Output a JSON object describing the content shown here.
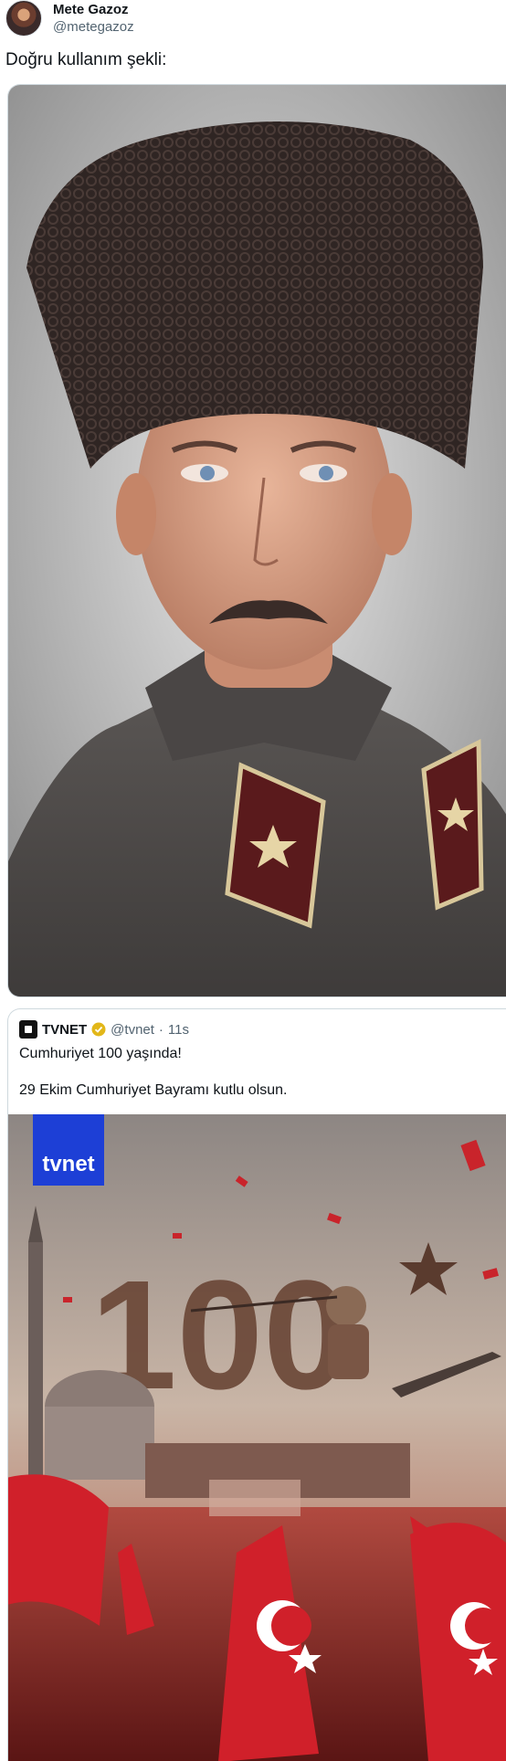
{
  "author": {
    "name": "Mete Gazoz",
    "handle": "@metegazoz"
  },
  "tweet": {
    "text": "Doğru kullanım şekli:"
  },
  "quoted": {
    "name": "TVNET",
    "handle": "@tvnet",
    "separator": "·",
    "time": "11s",
    "line1": "Cumhuriyet 100 yaşında!",
    "line2": "29 Ekim Cumhuriyet Bayramı kutlu olsun.",
    "image": {
      "logo_text": "tvnet",
      "big_number": "100"
    }
  },
  "colors": {
    "text": "#0f1419",
    "secondary": "#536471",
    "border": "#cfd9de",
    "verified": "#e2b719",
    "flag_red": "#d0202a",
    "tvnet_blue": "#1d3fd6"
  }
}
